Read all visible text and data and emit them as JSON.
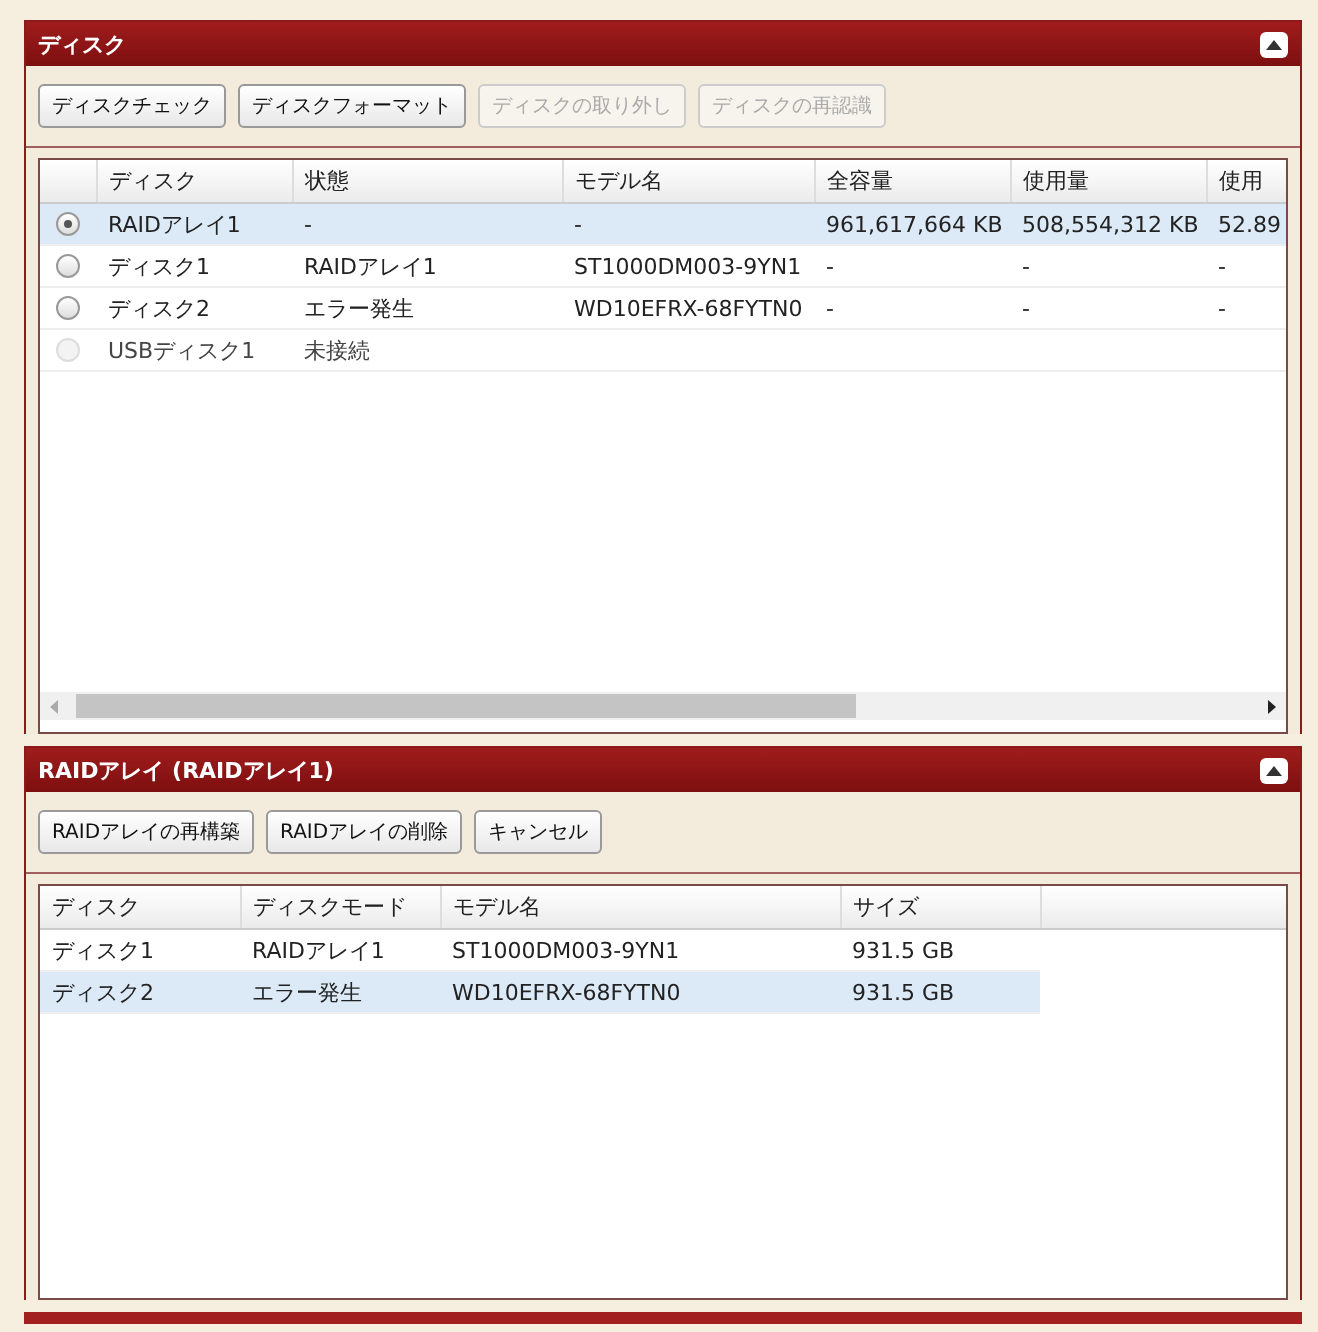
{
  "disk_panel": {
    "title": "ディスク",
    "buttons": [
      {
        "label": "ディスクチェック",
        "disabled": false
      },
      {
        "label": "ディスクフォーマット",
        "disabled": false
      },
      {
        "label": "ディスクの取り外し",
        "disabled": true
      },
      {
        "label": "ディスクの再認識",
        "disabled": true
      }
    ],
    "table": {
      "columns": [
        "ディスク",
        "状態",
        "モデル名",
        "全容量",
        "使用量",
        "使用"
      ],
      "rows": [
        {
          "selected": true,
          "disabled": false,
          "cells": [
            "RAIDアレイ1",
            "-",
            "-",
            "961,617,664 KB",
            "508,554,312 KB",
            "52.89"
          ]
        },
        {
          "selected": false,
          "disabled": false,
          "cells": [
            "ディスク1",
            "RAIDアレイ1",
            "ST1000DM003-9YN1",
            "-",
            "-",
            "-"
          ]
        },
        {
          "selected": false,
          "disabled": false,
          "cells": [
            "ディスク2",
            "エラー発生",
            "WD10EFRX-68FYTN0",
            "-",
            "-",
            "-"
          ]
        },
        {
          "selected": false,
          "disabled": true,
          "cells": [
            "USBディスク1",
            "未接続",
            "",
            "",
            "",
            ""
          ]
        }
      ]
    }
  },
  "raid_panel": {
    "title": "RAIDアレイ (RAIDアレイ1)",
    "buttons": [
      {
        "label": "RAIDアレイの再構築",
        "disabled": false
      },
      {
        "label": "RAIDアレイの削除",
        "disabled": false
      },
      {
        "label": "キャンセル",
        "disabled": false
      }
    ],
    "table": {
      "columns": [
        "ディスク",
        "ディスクモード",
        "モデル名",
        "サイズ"
      ],
      "rows": [
        {
          "selected": false,
          "cells": [
            "ディスク1",
            "RAIDアレイ1",
            "ST1000DM003-9YN1",
            "931.5 GB"
          ]
        },
        {
          "selected": true,
          "cells": [
            "ディスク2",
            "エラー発生",
            "WD10EFRX-68FYTN0",
            "931.5 GB"
          ]
        }
      ]
    }
  }
}
